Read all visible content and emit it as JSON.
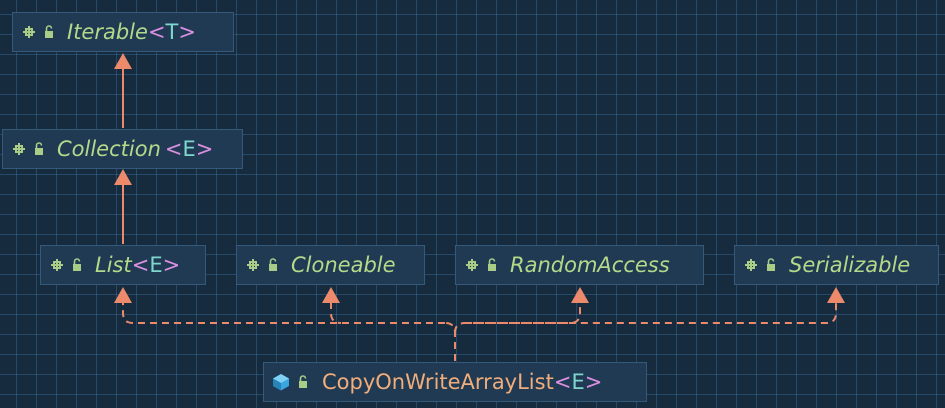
{
  "diagram": {
    "title": "",
    "nodes": {
      "iterable": {
        "name": "Iterable",
        "generic": "T",
        "kind": "interface",
        "icon": "interface-icon"
      },
      "collection": {
        "name": "Collection",
        "generic": "E",
        "kind": "interface",
        "icon": "interface-icon"
      },
      "list": {
        "name": "List",
        "generic": "E",
        "kind": "interface",
        "icon": "interface-icon"
      },
      "cloneable": {
        "name": "Cloneable",
        "generic": "",
        "kind": "interface",
        "icon": "interface-icon"
      },
      "random_access": {
        "name": "RandomAccess",
        "generic": "",
        "kind": "interface",
        "icon": "interface-icon"
      },
      "serializable": {
        "name": "Serializable",
        "generic": "",
        "kind": "interface",
        "icon": "interface-icon"
      },
      "copy_on_write": {
        "name": "CopyOnWriteArrayList",
        "generic": "E",
        "kind": "class",
        "icon": "class-icon"
      }
    },
    "brackets": {
      "open": "<",
      "close": ">"
    },
    "edges": [
      {
        "from": "collection",
        "to": "iterable",
        "style": "solid",
        "meaning": "extends"
      },
      {
        "from": "list",
        "to": "collection",
        "style": "solid",
        "meaning": "extends"
      },
      {
        "from": "copy_on_write",
        "to": "list",
        "style": "dashed",
        "meaning": "implements"
      },
      {
        "from": "copy_on_write",
        "to": "cloneable",
        "style": "dashed",
        "meaning": "implements"
      },
      {
        "from": "copy_on_write",
        "to": "random_access",
        "style": "dashed",
        "meaning": "implements"
      },
      {
        "from": "copy_on_write",
        "to": "serializable",
        "style": "dashed",
        "meaning": "implements"
      }
    ],
    "colors": {
      "background": "#162b3e",
      "grid": "#2e5b86",
      "node_fill": "#1f3a52",
      "node_border": "#35597a",
      "interface_text": "#b5d98a",
      "class_text": "#f2ad7b",
      "generic_param": "#7fd6d0",
      "angle_brackets": "#d990e0",
      "arrow": "#ec8a6b",
      "interface_icon": "#a9cc86",
      "class_icon": "#3aa6e0",
      "lock_icon": "#a9cc86"
    }
  }
}
